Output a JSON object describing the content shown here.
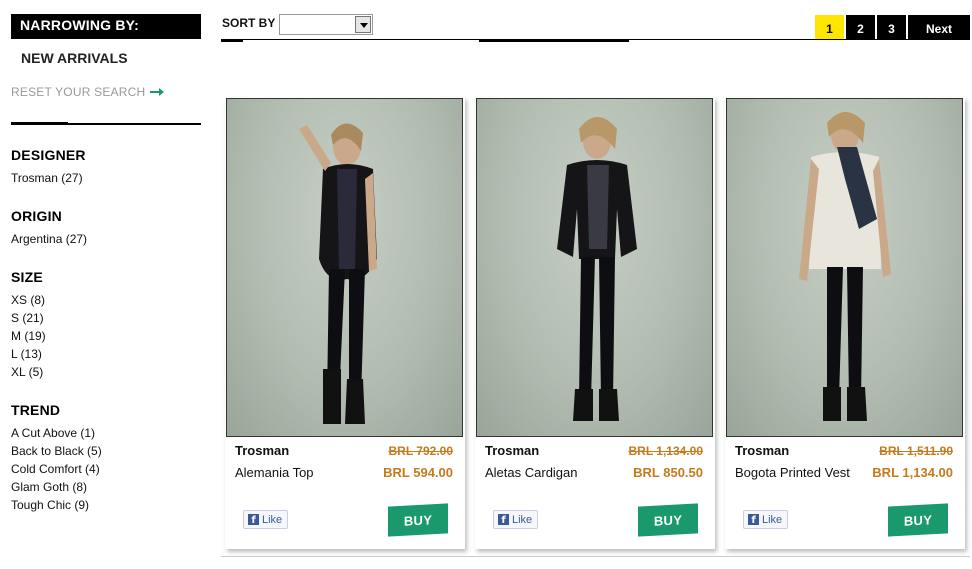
{
  "sidebar": {
    "narrowing_title": "NARROWING BY:",
    "active_filter": "NEW ARRIVALS",
    "reset_label": "RESET YOUR SEARCH",
    "groups": [
      {
        "title": "DESIGNER",
        "items": [
          "Trosman (27)"
        ]
      },
      {
        "title": "ORIGIN",
        "items": [
          "Argentina (27)"
        ]
      },
      {
        "title": "SIZE",
        "items": [
          "XS (8)",
          "S (21)",
          "M (19)",
          "L (13)",
          "XL (5)"
        ]
      },
      {
        "title": "TREND",
        "items": [
          "A Cut Above (1)",
          "Back to Black (5)",
          "Cold Comfort (4)",
          "Glam Goth (8)",
          "Tough Chic (9)"
        ]
      }
    ]
  },
  "toolbar": {
    "sort_label": "SORT BY",
    "sort_value": ""
  },
  "pagination": {
    "pages": [
      "1",
      "2",
      "3"
    ],
    "active_page": "1",
    "next_label": "Next"
  },
  "products": [
    {
      "brand": "Trosman",
      "name": "Alemania Top",
      "old_price": "BRL 792.00",
      "price": "BRL 594.00",
      "like_label": "Like",
      "buy_label": "BUY"
    },
    {
      "brand": "Trosman",
      "name": "Aletas Cardigan",
      "old_price": "BRL 1,134.00",
      "price": "BRL 850.50",
      "like_label": "Like",
      "buy_label": "BUY"
    },
    {
      "brand": "Trosman",
      "name": "Bogota Printed Vest",
      "old_price": "BRL 1,511.90",
      "price": "BRL 1,134.00",
      "like_label": "Like",
      "buy_label": "BUY"
    }
  ],
  "colors": {
    "accent_green": "#1a9a6c",
    "price_orange": "#c67a1c",
    "active_page_yellow": "#ffe600"
  }
}
